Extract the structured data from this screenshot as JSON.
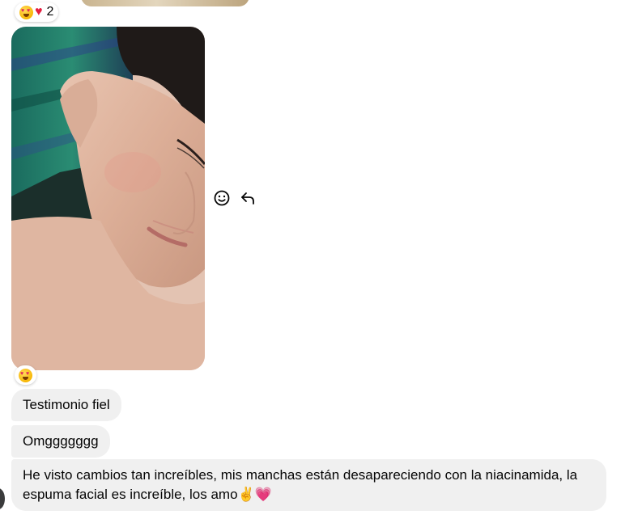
{
  "previous_message": {
    "reactions": {
      "emojis": [
        "heart-eyes-emoji",
        "heart-emoji"
      ],
      "count": "2"
    }
  },
  "photo_message": {
    "reactions": {
      "emojis": [
        "heart-eyes-emoji"
      ]
    },
    "hover_actions": [
      "react-icon",
      "reply-icon"
    ]
  },
  "messages": [
    {
      "text": "Testimonio fiel"
    },
    {
      "text": "Omggggggg"
    },
    {
      "text": "He visto cambios tan increíbles, mis manchas están desapareciendo con la niacinamida, la espuma facial es increíble, los amo✌️💗"
    }
  ],
  "colors": {
    "bubble_bg": "#f0f0f0",
    "text": "#050505",
    "heart": "#e41e3f"
  }
}
